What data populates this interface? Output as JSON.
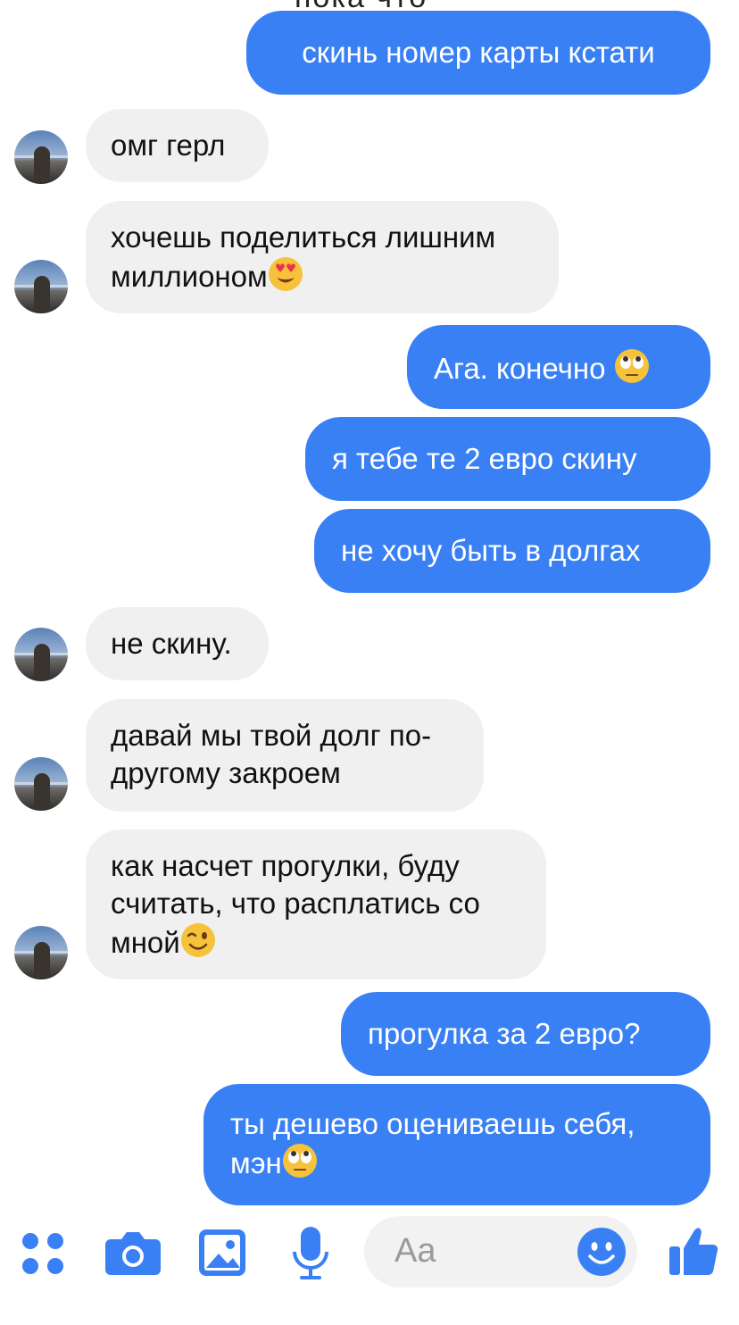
{
  "partial_top_text": "пока что",
  "messages": [
    {
      "side": "out",
      "text": "скинь номер карты кстати"
    },
    {
      "side": "in",
      "text": "омг герл"
    },
    {
      "side": "in",
      "line1": "хочешь поделиться лишним",
      "line2": "миллионом",
      "emoji": "heart-eyes-emoji"
    },
    {
      "side": "out",
      "text": "Ага. конечно",
      "emoji": "eye-roll-emoji"
    },
    {
      "side": "out",
      "text": "я тебе те 2 евро скину"
    },
    {
      "side": "out",
      "text": "не хочу быть в долгах"
    },
    {
      "side": "in",
      "text": "не скину."
    },
    {
      "side": "in",
      "line1": "давай мы твой долг по-",
      "line2": "другому закроем"
    },
    {
      "side": "in",
      "line1": "как насчет прогулки, буду",
      "line2": "считать, что расплатись со",
      "line3": "мной",
      "emoji": "wink-emoji"
    },
    {
      "side": "out",
      "text": "прогулка за 2 евро?"
    },
    {
      "side": "out",
      "line1": "ты дешево оцениваешь себя,",
      "line2": "мэн",
      "emoji": "eye-roll-emoji"
    }
  ],
  "composer": {
    "placeholder": "Aa",
    "icons": [
      "menu-dots-icon",
      "camera-icon",
      "photo-icon",
      "microphone-icon",
      "smiley-icon",
      "thumbs-up-icon"
    ]
  },
  "colors": {
    "outgoing_bubble": "#3a80f5",
    "incoming_bubble": "#f0f0f0",
    "accent": "#3a80f5"
  }
}
